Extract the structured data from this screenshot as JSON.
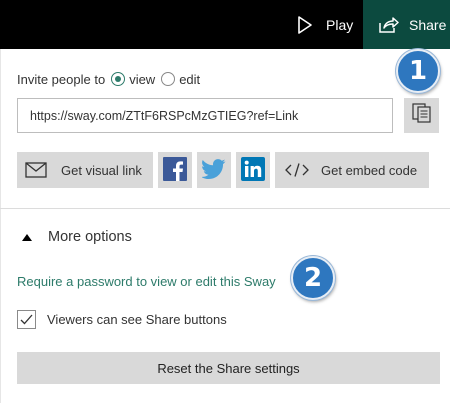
{
  "topbar": {
    "play_label": "Play",
    "play_icon": "play-icon",
    "share_label": "Share",
    "share_icon": "share-icon",
    "share_bg": "#0c4a3f"
  },
  "invite": {
    "label": "Invite people to",
    "options": [
      {
        "label": "view",
        "selected": true
      },
      {
        "label": "edit",
        "selected": false
      }
    ]
  },
  "link": {
    "value": "https://sway.com/ZTtF6RSPcMzGTIEG?ref=Link",
    "copy_icon": "copy-icon"
  },
  "share_buttons": {
    "visual_link_label": "Get visual link",
    "visual_link_icon": "mail-icon",
    "facebook_icon": "facebook-icon",
    "twitter_icon": "twitter-icon",
    "linkedin_icon": "linkedin-icon",
    "embed_label": "Get embed code",
    "embed_icon": "code-icon",
    "facebook_color": "#3b5998",
    "twitter_color": "#4aa1d9",
    "linkedin_color": "#0077b5"
  },
  "more_options": {
    "label": "More options",
    "icon": "caret-up-icon"
  },
  "password_link": "Require a password to view or edit this Sway",
  "viewers_checkbox": {
    "label": "Viewers can see Share buttons",
    "checked": true
  },
  "reset_label": "Reset the Share settings",
  "badges": [
    "1",
    "2"
  ],
  "accent": "#2d7b6a",
  "badge_color": "#2e77bf"
}
